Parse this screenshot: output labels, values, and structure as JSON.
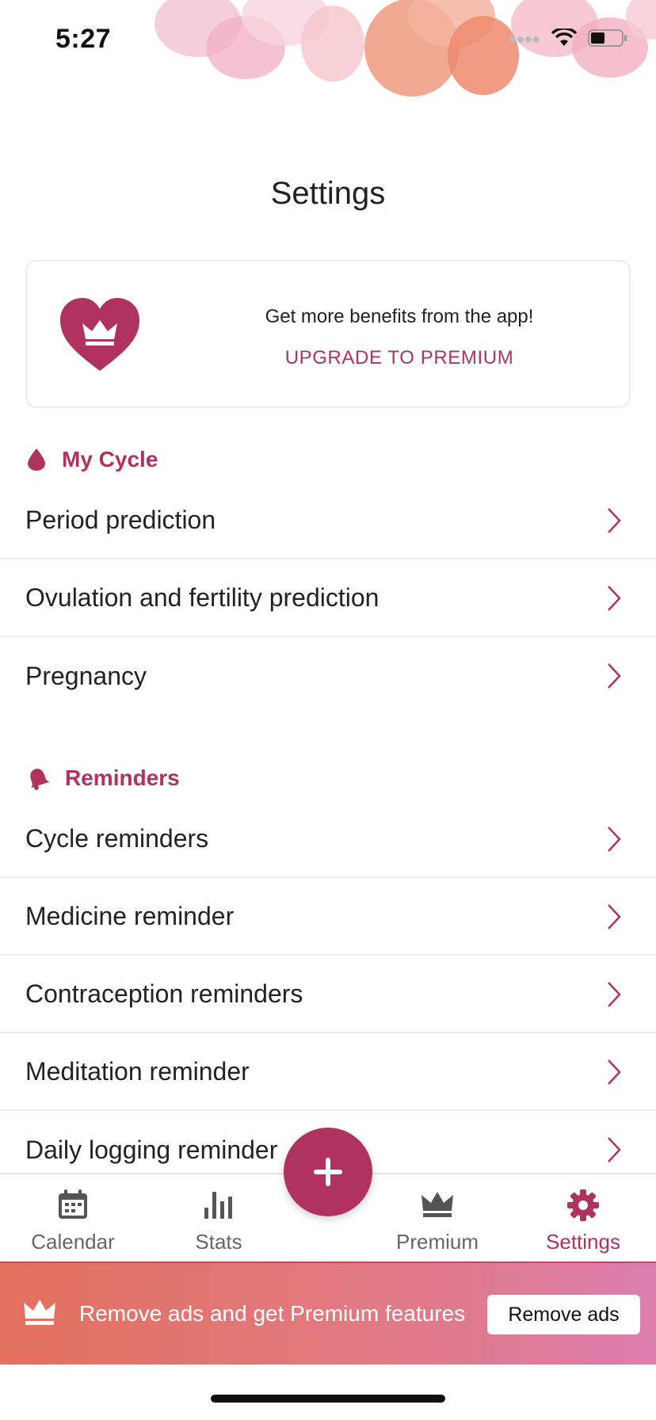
{
  "status_bar": {
    "time": "5:27"
  },
  "page": {
    "title": "Settings"
  },
  "premium_card": {
    "tagline": "Get more benefits from the app!",
    "link_label": "UPGRADE TO PREMIUM"
  },
  "sections": {
    "my_cycle": {
      "title": "My Cycle",
      "icon": "drop-icon",
      "items": [
        "Period prediction",
        "Ovulation and fertility prediction",
        "Pregnancy"
      ]
    },
    "reminders": {
      "title": "Reminders",
      "icon": "bell-icon",
      "items": [
        "Cycle reminders",
        "Medicine reminder",
        "Contraception reminders",
        "Meditation reminder",
        "Daily logging reminder"
      ]
    }
  },
  "tabbar": {
    "tabs": [
      {
        "label": "Calendar",
        "icon": "calendar-icon"
      },
      {
        "label": "Stats",
        "icon": "bar-chart-icon"
      },
      {
        "label": "Premium",
        "icon": "crown-icon"
      },
      {
        "label": "Settings",
        "icon": "gear-icon",
        "active": true
      }
    ],
    "fab_icon": "plus-icon"
  },
  "ad_banner": {
    "text": "Remove ads and get Premium features",
    "button_label": "Remove ads"
  },
  "colors": {
    "accent": "#b0325f",
    "banner_start": "#e4705e",
    "banner_end": "#dc7dae"
  }
}
